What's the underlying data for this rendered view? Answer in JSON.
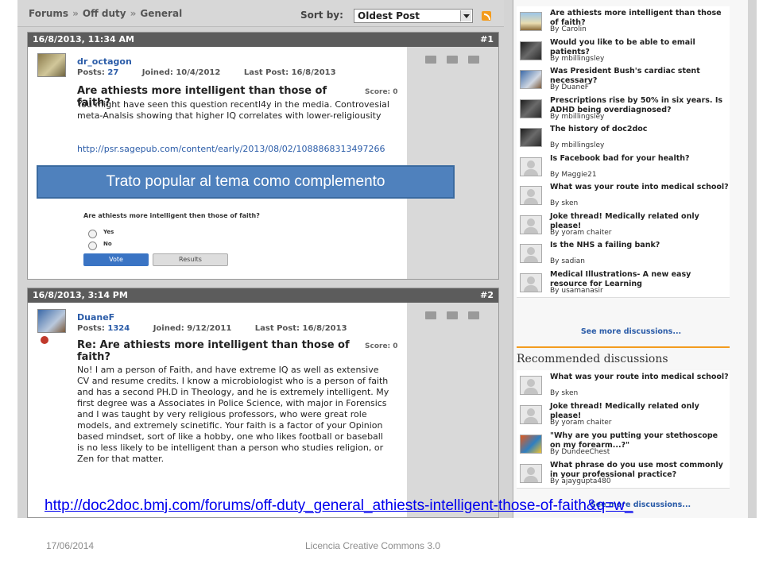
{
  "breadcrumb": {
    "items": [
      "Forums",
      "Off duty",
      "General"
    ],
    "separator": "»"
  },
  "sort": {
    "label": "Sort by:",
    "value": "Oldest Post"
  },
  "posts": [
    {
      "date": "16/8/2013, 11:34 AM",
      "number": "#1",
      "author": "dr_octagon",
      "posts_label": "Posts:",
      "posts_count": "27",
      "joined": "Joined: 10/4/2012",
      "last_post": "Last Post: 16/8/2013",
      "score": "Score: 0",
      "title": "Are athiests more intelligent than those of faith?",
      "body": "You might have seen this question recentl4y in the media. Controvesial meta-Analsis showing that higher IQ correlates with lower-religiousity",
      "link": "http://psr.sagepub.com/content/early/2013/08/02/1088868313497266",
      "poll": {
        "question": "Are athiests more intelligent then those of faith?",
        "options": [
          "Yes",
          "No"
        ],
        "vote_label": "Vote",
        "results_label": "Results"
      }
    },
    {
      "date": "16/8/2013, 3:14 PM",
      "number": "#2",
      "author": "DuaneF",
      "posts_label": "Posts:",
      "posts_count": "1324",
      "joined": "Joined: 9/12/2011",
      "last_post": "Last Post: 16/8/2013",
      "score": "Score: 0",
      "title": "Re: Are athiests more intelligent than those of faith?",
      "body": "No!  I am a person of Faith, and have extreme IQ as well as extensive CV and resume credits.   I know a microbiologist who is a person of faith and has a second PH.D in Theology,  and he is extremely intelligent.  My first degree was a Associates in Police Science, with major in Forensics and I was taught by very religious professors, who were great role models, and extremely scinetific.  Your faith is a factor of your Opinion based mindset,  sort of like a hobby,   one who likes football or baseball is no less likely to be intelligent than a person who studies religion,  or Zen for that matter."
    }
  ],
  "latest_discussions": [
    {
      "title": "Are athiests more intelligent than those of faith?",
      "by": "By Carolin",
      "avatar": "p1"
    },
    {
      "title": "Would you like to be able to email patients?",
      "by": "By mbillingsley",
      "avatar": "p2"
    },
    {
      "title": "Was President Bush's cardiac stent necessary?",
      "by": "By DuaneF",
      "avatar": "p3"
    },
    {
      "title": "Prescriptions rise by 50% in six years. Is ADHD being overdiagnosed?",
      "by": "By mbillingsley",
      "avatar": "p2"
    },
    {
      "title": "The history of doc2doc",
      "by": "By mbillingsley",
      "avatar": "p2"
    },
    {
      "title": "Is Facebook bad for your health?",
      "by": "By Maggie21",
      "avatar": "gen"
    },
    {
      "title": "What was your route into medical school?",
      "by": "By sken",
      "avatar": "gen"
    },
    {
      "title": "Joke thread! Medically related only please!",
      "by": "By yoram chaiter",
      "avatar": "gen"
    },
    {
      "title": "Is the NHS a failing bank?",
      "by": "By sadian",
      "avatar": "gen"
    },
    {
      "title": "Medical Illustrations- A new easy resource for Learning",
      "by": "By usamanasir",
      "avatar": "gen"
    }
  ],
  "see_more": "See more discussions...",
  "recommended": {
    "heading": "Recommended discussions",
    "items": [
      {
        "title": "What was your route into medical school?",
        "by": "By sken",
        "avatar": "gen"
      },
      {
        "title": "Joke thread! Medically related only please!",
        "by": "By yoram chaiter",
        "avatar": "gen"
      },
      {
        "title": "\"Why are you putting your stethoscope on my forearm...?\"",
        "by": "By DundeeChest",
        "avatar": "p4"
      },
      {
        "title": "What phrase do you use most commonly in your professional practice?",
        "by": "By ajaygupta480",
        "avatar": "gen"
      }
    ]
  },
  "banner": "Trato popular al tema como complemento",
  "url": "http://doc2doc.bmj.com/forums/off-duty_general_athiests-intelligent-those-of-faith&q=w_",
  "footer": {
    "date": "17/06/2014",
    "license": "Licencia Creative Commons 3.0"
  },
  "colors": {
    "banner": "#4f81bd",
    "accent": "#f39c1f",
    "link": "#2b5ca8"
  }
}
